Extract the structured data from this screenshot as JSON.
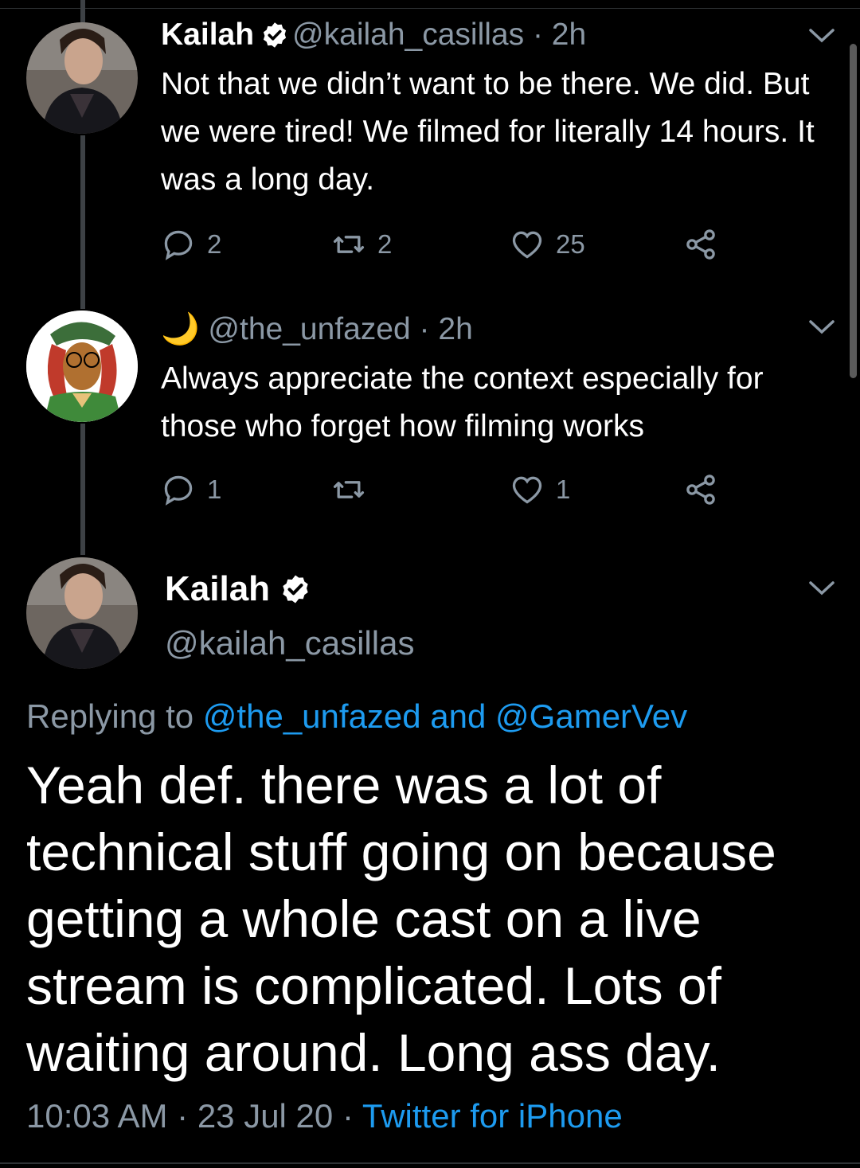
{
  "tweets": [
    {
      "name": "Kailah",
      "handle": "@kailah_casillas",
      "time": "2h",
      "text": "Not that we didn’t want to be there. We did. But we were tired! We filmed for literally 14 hours. It was a long day.",
      "replies": "2",
      "retweets": "2",
      "likes": "25"
    },
    {
      "name_emoji": "🌙",
      "handle": "@the_unfazed",
      "time": "2h",
      "text": "Always appreciate the context especially for those who forget how filming works",
      "replies": "1",
      "retweets": "",
      "likes": "1"
    }
  ],
  "main_tweet": {
    "name": "Kailah",
    "handle": "@kailah_casillas",
    "replying_label": "Replying to",
    "replying_to": "@the_unfazed and @GamerVev",
    "text": "Yeah def. there was a lot of technical stuff going on because getting a whole cast on a live stream is complicated. Lots of waiting around. Long ass day.",
    "time": "10:03 AM",
    "date": "23 Jul 20",
    "source": "Twitter for iPhone"
  },
  "separator": "·",
  "colors": {
    "background": "#000000",
    "secondary": "#8b98a5",
    "link": "#1d9bf0",
    "verified": "#ffffff"
  }
}
